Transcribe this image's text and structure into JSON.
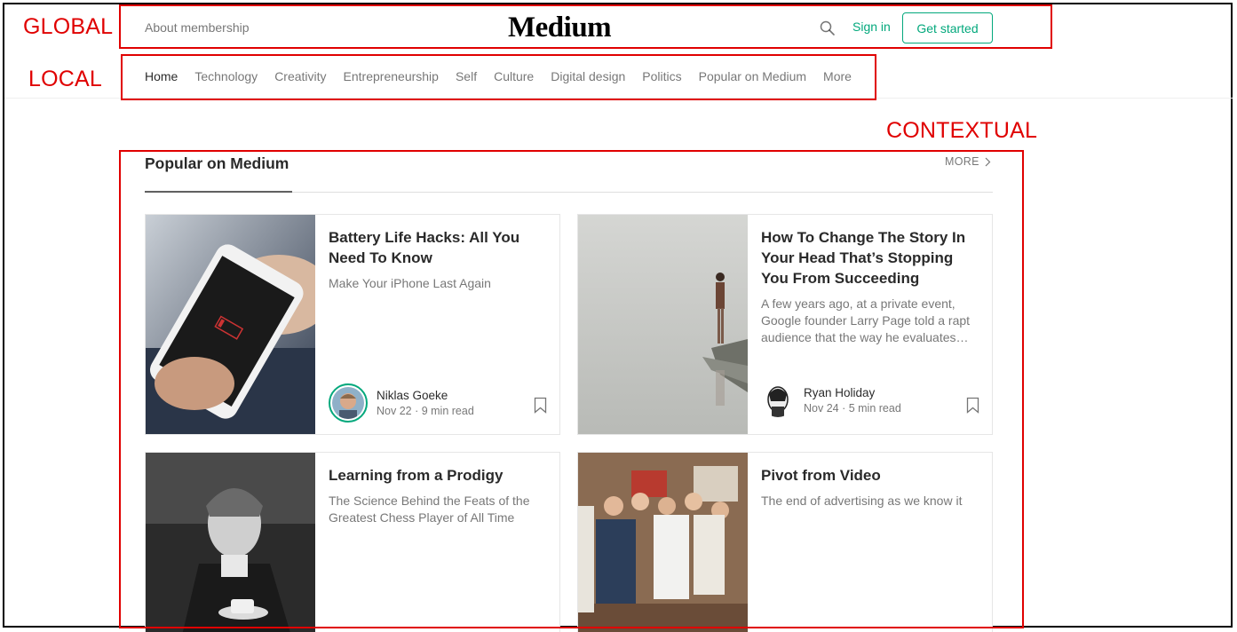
{
  "annotations": {
    "global": "GLOBAL",
    "local": "LOCAL",
    "contextual": "CONTEXTUAL",
    "color": "#e00000"
  },
  "header": {
    "about_link": "About membership",
    "logo": "Medium",
    "search_icon": "search-icon",
    "sign_in": "Sign in",
    "get_started": "Get started",
    "accent": "#03a87c"
  },
  "nav": {
    "items": [
      {
        "label": "Home",
        "active": true
      },
      {
        "label": "Technology"
      },
      {
        "label": "Creativity"
      },
      {
        "label": "Entrepreneurship"
      },
      {
        "label": "Self"
      },
      {
        "label": "Culture"
      },
      {
        "label": "Digital design"
      },
      {
        "label": "Politics"
      },
      {
        "label": "Popular on Medium"
      },
      {
        "label": "More"
      }
    ]
  },
  "section": {
    "title": "Popular on Medium",
    "more": "MORE",
    "more_icon": "chevron-right-icon"
  },
  "cards": [
    {
      "title": "Battery Life Hacks: All You Need To Know",
      "subtitle": "Make Your iPhone Last Again",
      "author": "Niklas Goeke",
      "meta": "Nov 22 · 9 min read",
      "image": "phone-low-battery-photo",
      "bookmark_icon": "bookmark-icon"
    },
    {
      "title": "How To Change The Story In Your Head That’s Stopping You From Succeeding",
      "subtitle": "A few years ago, at a private event, Google founder Larry Page told a rapt audience that the way he evaluates…",
      "author": "Ryan Holiday",
      "meta": "Nov 24 · 5 min read",
      "image": "woman-standing-in-water-photo",
      "bookmark_icon": "bookmark-icon"
    },
    {
      "title": "Learning from a Prodigy",
      "subtitle": "The Science Behind the Feats of the Greatest Chess Player of All Time",
      "image": "young-man-chess-player-photo"
    },
    {
      "title": "Pivot from Video",
      "subtitle": "The end of advertising as we know it",
      "image": "office-team-vintage-photo"
    }
  ]
}
